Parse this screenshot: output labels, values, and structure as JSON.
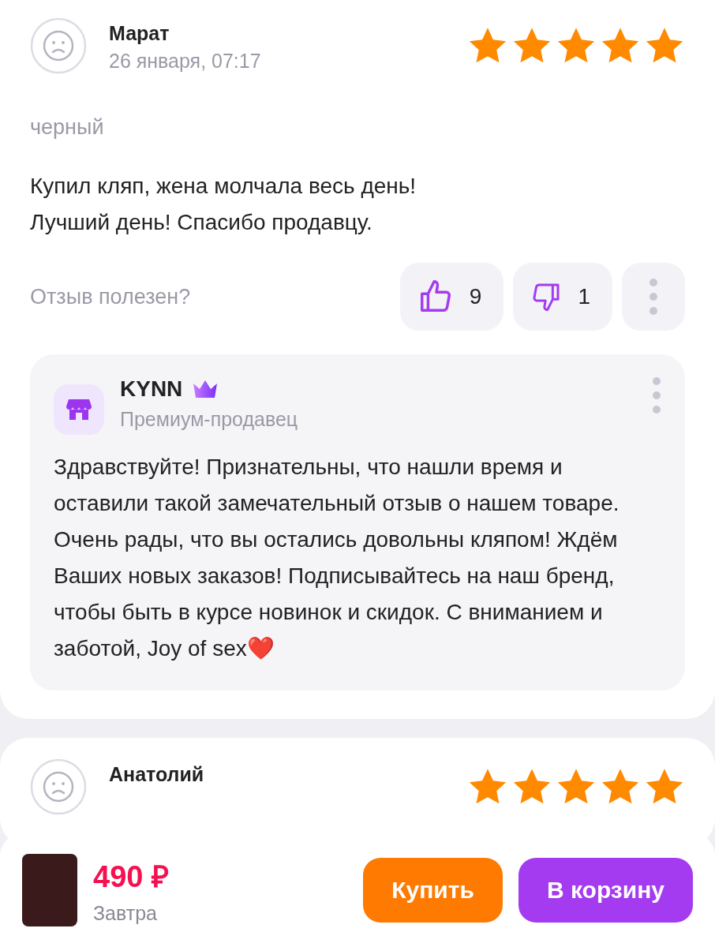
{
  "reviews": [
    {
      "author": "Марат",
      "date": "26 января, 07:17",
      "stars": 5,
      "variant": "черный",
      "text": "Купил кляп, жена молчала весь день!\nЛучший день! Спасибо продавцу.",
      "helpful_question": "Отзыв полезен?",
      "likes": "9",
      "dislikes": "1",
      "reply": {
        "seller": "KYNN",
        "premium": true,
        "seller_status": "Премиум-продавец",
        "text": "Здравствуйте! Признательны, что нашли время и оставили такой замечательный отзыв о нашем товаре. Очень рады, что вы остались довольны кляпом! Ждём Ваших новых заказов! Подписывайтесь на наш бренд, чтобы быть в курсе новинок и скидок. С вниманием и заботой, Joy of sex❤️"
      }
    },
    {
      "author": "Анатолий",
      "stars": 5
    }
  ],
  "bottom_bar": {
    "price": "490 ₽",
    "delivery": "Завтра",
    "buttons": [
      {
        "label": "Купить",
        "kind": "buy"
      },
      {
        "label": "В корзину",
        "kind": "cart"
      }
    ]
  }
}
